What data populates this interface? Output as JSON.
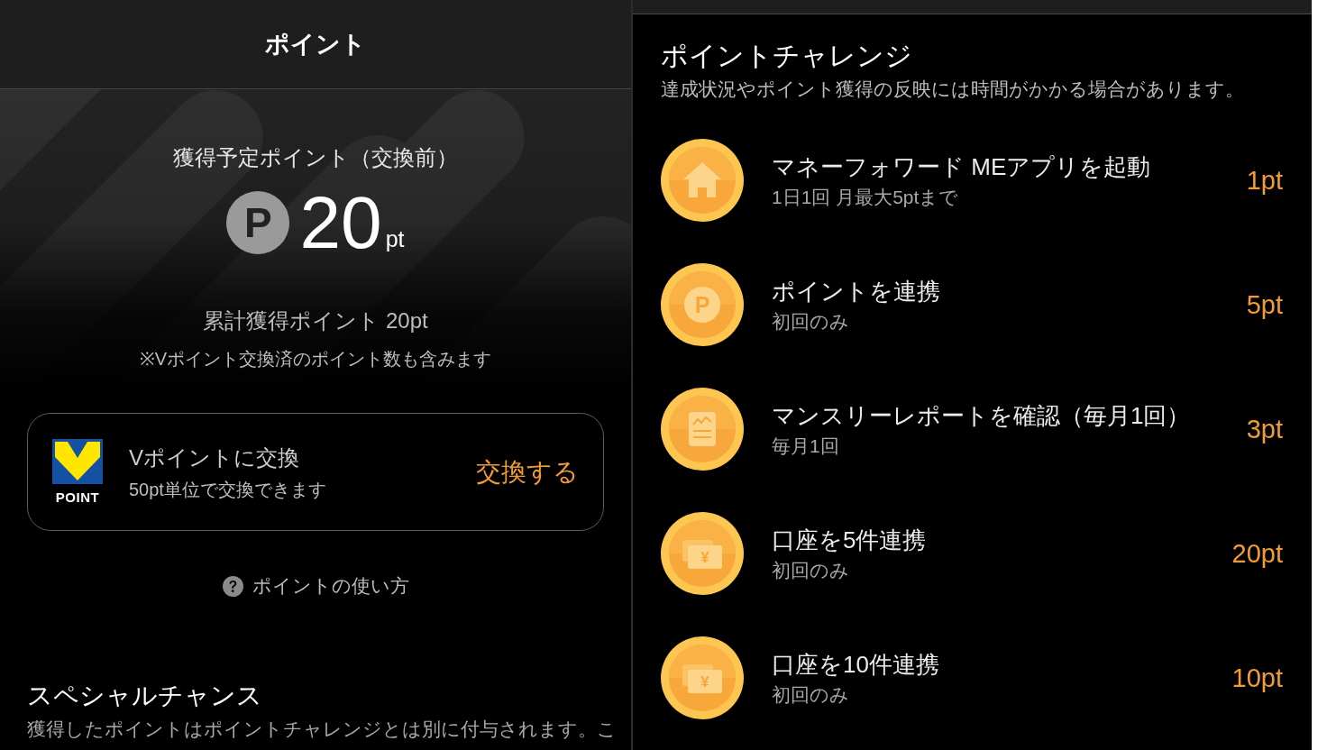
{
  "left_panel": {
    "header": {
      "title": "ポイント"
    },
    "summary": {
      "label": "獲得予定ポイント（交換前）",
      "badge": "P",
      "amount": "20",
      "unit": "pt",
      "total": "累計獲得ポイント 20pt",
      "note": "※Vポイント交換済のポイント数も含みます"
    },
    "exchange_card": {
      "logo_text": "POINT",
      "title": "Vポイントに交換",
      "subtitle": "50pt単位で交換できます",
      "action": "交換する"
    },
    "help_link": "ポイントの使い方",
    "special_chance": {
      "title": "スペシャルチャンス",
      "description": "獲得したポイントはポイントチャレンジとは別に付与されます。こ"
    }
  },
  "right_panel": {
    "title": "ポイントチャレンジ",
    "subtitle": "達成状況やポイント獲得の反映には時間がかかる場合があります。",
    "challenges": [
      {
        "kind": "home",
        "title": "マネーフォワード MEアプリを起動",
        "condition": "1日1回 月最大5ptまで",
        "points": "1pt"
      },
      {
        "kind": "point",
        "icon_label": "P",
        "title": "ポイントを連携",
        "condition": "初回のみ",
        "points": "5pt"
      },
      {
        "kind": "report",
        "title": "マンスリーレポートを確認（毎月1回）",
        "condition": "毎月1回",
        "points": "3pt"
      },
      {
        "kind": "account",
        "icon_label": "¥",
        "title": "口座を5件連携",
        "condition": "初回のみ",
        "points": "20pt"
      },
      {
        "kind": "account",
        "icon_label": "¥",
        "title": "口座を10件連携",
        "condition": "初回のみ",
        "points": "10pt"
      }
    ]
  }
}
